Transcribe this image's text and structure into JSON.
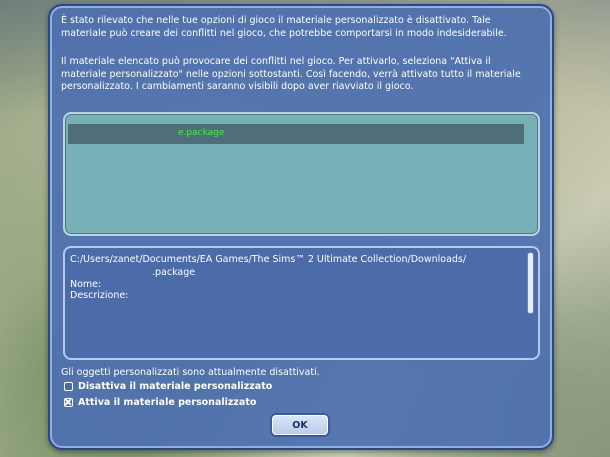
{
  "dialog": {
    "message_1": "È stato rilevato che nelle tue opzioni di gioco il materiale personalizzato è disattivato. Tale materiale può creare dei conflitti nel gioco, che potrebbe comportarsi in modo indesiderabile.",
    "message_2": "Il materiale elencato può provocare dei conflitti nel gioco. Per attivarlo, seleziona \"Attiva il materiale personalizzato\" nelle opzioni sottostanti. Così facendo, verrà attivato tutto il materiale personalizzato. I cambiamenti saranno visibili dopo aver riavviato il gioco.",
    "package_list": [
      {
        "name": "e.package",
        "selected": true,
        "color": "#3df33d"
      }
    ],
    "details": {
      "path": "C:/Users/zanet/Documents/EA Games/The Sims™ 2 Ultimate Collection/Downloads/",
      "filename": ".package",
      "nome_label": "Nome:",
      "descrizione_label": "Descrizione:"
    },
    "status_text": "Gli oggetti personalizzati sono attualmente disattivati.",
    "options": [
      {
        "label": "Disattiva il materiale personalizzato",
        "checked": false
      },
      {
        "label": "Attiva il materiale personalizzato",
        "checked": true
      }
    ],
    "ok_label": "OK"
  },
  "colors": {
    "dialog_bg": "#4e70af",
    "list_bg": "#78b0b8",
    "selected_row": "#4f6e7a",
    "highlight_text": "#3df33d"
  }
}
